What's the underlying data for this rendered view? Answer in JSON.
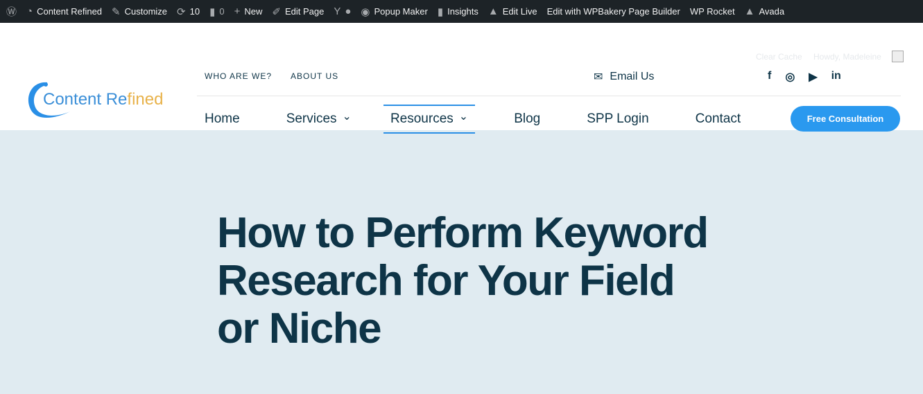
{
  "adminbar": {
    "items": [
      {
        "icon": "wordpress-icon",
        "label": ""
      },
      {
        "icon": "dashboard-icon",
        "label": "Content Refined"
      },
      {
        "icon": "brush-icon",
        "label": "Customize"
      },
      {
        "icon": "updates-icon",
        "label": "10"
      },
      {
        "icon": "comment-icon",
        "label": "0"
      },
      {
        "icon": "plus-icon",
        "label": "New"
      },
      {
        "icon": "pencil-icon",
        "label": "Edit Page"
      },
      {
        "icon": "yoast-icon",
        "label": ""
      },
      {
        "icon": "popup-maker-icon",
        "label": "Popup Maker"
      },
      {
        "icon": "bar-chart-icon",
        "label": "Insights"
      },
      {
        "icon": "avada-icon",
        "label": "Edit Live"
      },
      {
        "icon": "",
        "label": "Edit with WPBakery Page Builder"
      },
      {
        "icon": "",
        "label": "WP Rocket"
      },
      {
        "icon": "avada-icon",
        "label": "Avada"
      }
    ],
    "clear_cache": "Clear Cache",
    "howdy": "Howdy, Madeleine"
  },
  "header": {
    "logo_text_1": "Content Re",
    "logo_text_2": "fined",
    "top_links": [
      "WHO ARE WE?",
      "ABOUT US"
    ],
    "email": "Email Us",
    "social": [
      "facebook-icon",
      "instagram-icon",
      "youtube-icon",
      "linkedin-icon"
    ],
    "nav": [
      {
        "label": "Home"
      },
      {
        "label": "Services",
        "dropdown": true
      },
      {
        "label": "Resources",
        "dropdown": true,
        "active": true
      },
      {
        "label": "Blog"
      },
      {
        "label": "SPP Login"
      },
      {
        "label": "Contact"
      }
    ],
    "cta": "Free Consultation"
  },
  "hero": {
    "title": "How to Perform Keyword Research for Your Field or Niche"
  },
  "colors": {
    "accent": "#2a99ef",
    "text": "#0e3447",
    "hero_bg": "#e0ebf1"
  }
}
